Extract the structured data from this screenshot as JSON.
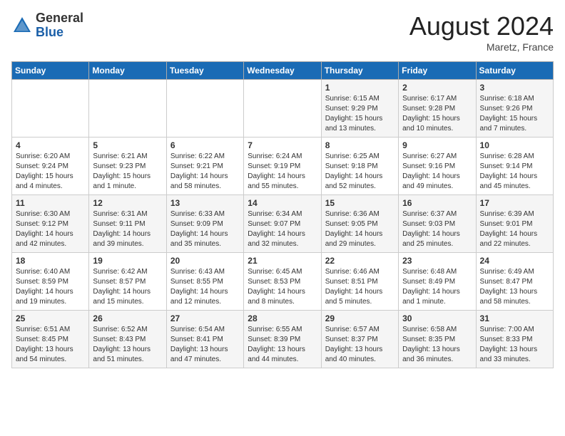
{
  "header": {
    "logo_general": "General",
    "logo_blue": "Blue",
    "title": "August 2024",
    "location": "Maretz, France"
  },
  "days_of_week": [
    "Sunday",
    "Monday",
    "Tuesday",
    "Wednesday",
    "Thursday",
    "Friday",
    "Saturday"
  ],
  "weeks": [
    [
      {
        "day": "",
        "info": ""
      },
      {
        "day": "",
        "info": ""
      },
      {
        "day": "",
        "info": ""
      },
      {
        "day": "",
        "info": ""
      },
      {
        "day": "1",
        "info": "Sunrise: 6:15 AM\nSunset: 9:29 PM\nDaylight: 15 hours\nand 13 minutes."
      },
      {
        "day": "2",
        "info": "Sunrise: 6:17 AM\nSunset: 9:28 PM\nDaylight: 15 hours\nand 10 minutes."
      },
      {
        "day": "3",
        "info": "Sunrise: 6:18 AM\nSunset: 9:26 PM\nDaylight: 15 hours\nand 7 minutes."
      }
    ],
    [
      {
        "day": "4",
        "info": "Sunrise: 6:20 AM\nSunset: 9:24 PM\nDaylight: 15 hours\nand 4 minutes."
      },
      {
        "day": "5",
        "info": "Sunrise: 6:21 AM\nSunset: 9:23 PM\nDaylight: 15 hours\nand 1 minute."
      },
      {
        "day": "6",
        "info": "Sunrise: 6:22 AM\nSunset: 9:21 PM\nDaylight: 14 hours\nand 58 minutes."
      },
      {
        "day": "7",
        "info": "Sunrise: 6:24 AM\nSunset: 9:19 PM\nDaylight: 14 hours\nand 55 minutes."
      },
      {
        "day": "8",
        "info": "Sunrise: 6:25 AM\nSunset: 9:18 PM\nDaylight: 14 hours\nand 52 minutes."
      },
      {
        "day": "9",
        "info": "Sunrise: 6:27 AM\nSunset: 9:16 PM\nDaylight: 14 hours\nand 49 minutes."
      },
      {
        "day": "10",
        "info": "Sunrise: 6:28 AM\nSunset: 9:14 PM\nDaylight: 14 hours\nand 45 minutes."
      }
    ],
    [
      {
        "day": "11",
        "info": "Sunrise: 6:30 AM\nSunset: 9:12 PM\nDaylight: 14 hours\nand 42 minutes."
      },
      {
        "day": "12",
        "info": "Sunrise: 6:31 AM\nSunset: 9:11 PM\nDaylight: 14 hours\nand 39 minutes."
      },
      {
        "day": "13",
        "info": "Sunrise: 6:33 AM\nSunset: 9:09 PM\nDaylight: 14 hours\nand 35 minutes."
      },
      {
        "day": "14",
        "info": "Sunrise: 6:34 AM\nSunset: 9:07 PM\nDaylight: 14 hours\nand 32 minutes."
      },
      {
        "day": "15",
        "info": "Sunrise: 6:36 AM\nSunset: 9:05 PM\nDaylight: 14 hours\nand 29 minutes."
      },
      {
        "day": "16",
        "info": "Sunrise: 6:37 AM\nSunset: 9:03 PM\nDaylight: 14 hours\nand 25 minutes."
      },
      {
        "day": "17",
        "info": "Sunrise: 6:39 AM\nSunset: 9:01 PM\nDaylight: 14 hours\nand 22 minutes."
      }
    ],
    [
      {
        "day": "18",
        "info": "Sunrise: 6:40 AM\nSunset: 8:59 PM\nDaylight: 14 hours\nand 19 minutes."
      },
      {
        "day": "19",
        "info": "Sunrise: 6:42 AM\nSunset: 8:57 PM\nDaylight: 14 hours\nand 15 minutes."
      },
      {
        "day": "20",
        "info": "Sunrise: 6:43 AM\nSunset: 8:55 PM\nDaylight: 14 hours\nand 12 minutes."
      },
      {
        "day": "21",
        "info": "Sunrise: 6:45 AM\nSunset: 8:53 PM\nDaylight: 14 hours\nand 8 minutes."
      },
      {
        "day": "22",
        "info": "Sunrise: 6:46 AM\nSunset: 8:51 PM\nDaylight: 14 hours\nand 5 minutes."
      },
      {
        "day": "23",
        "info": "Sunrise: 6:48 AM\nSunset: 8:49 PM\nDaylight: 14 hours\nand 1 minute."
      },
      {
        "day": "24",
        "info": "Sunrise: 6:49 AM\nSunset: 8:47 PM\nDaylight: 13 hours\nand 58 minutes."
      }
    ],
    [
      {
        "day": "25",
        "info": "Sunrise: 6:51 AM\nSunset: 8:45 PM\nDaylight: 13 hours\nand 54 minutes."
      },
      {
        "day": "26",
        "info": "Sunrise: 6:52 AM\nSunset: 8:43 PM\nDaylight: 13 hours\nand 51 minutes."
      },
      {
        "day": "27",
        "info": "Sunrise: 6:54 AM\nSunset: 8:41 PM\nDaylight: 13 hours\nand 47 minutes."
      },
      {
        "day": "28",
        "info": "Sunrise: 6:55 AM\nSunset: 8:39 PM\nDaylight: 13 hours\nand 44 minutes."
      },
      {
        "day": "29",
        "info": "Sunrise: 6:57 AM\nSunset: 8:37 PM\nDaylight: 13 hours\nand 40 minutes."
      },
      {
        "day": "30",
        "info": "Sunrise: 6:58 AM\nSunset: 8:35 PM\nDaylight: 13 hours\nand 36 minutes."
      },
      {
        "day": "31",
        "info": "Sunrise: 7:00 AM\nSunset: 8:33 PM\nDaylight: 13 hours\nand 33 minutes."
      }
    ]
  ]
}
